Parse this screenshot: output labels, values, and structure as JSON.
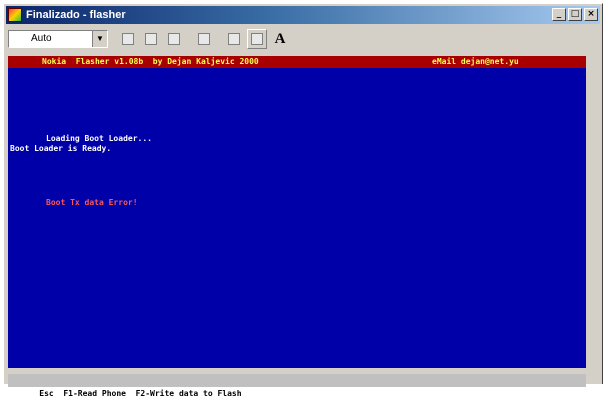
{
  "window": {
    "title": "Finalizado - flasher",
    "buttons": {
      "minimize": "_",
      "maximize": "□",
      "close": "×"
    }
  },
  "toolbar": {
    "font_select": "Auto",
    "dropdown_glyph": "▼",
    "font_button": "A"
  },
  "console": {
    "header_left": "Nokia  Flasher v1.08b  by Dejan Kaljevic 2000",
    "header_right": "eMail dejan@net.yu",
    "lines": [
      "Loading Boot Loader...",
      "Boot Loader is Ready."
    ],
    "error": "Boot Tx data Error!"
  },
  "statusbar": {
    "text": "Esc  F1-Read Phone  F2-Write data to Flash"
  },
  "colors": {
    "console_bg": "#0000a8",
    "header_bg": "#a80000",
    "header_fg": "#ffff55",
    "error_fg": "#ff5555"
  }
}
